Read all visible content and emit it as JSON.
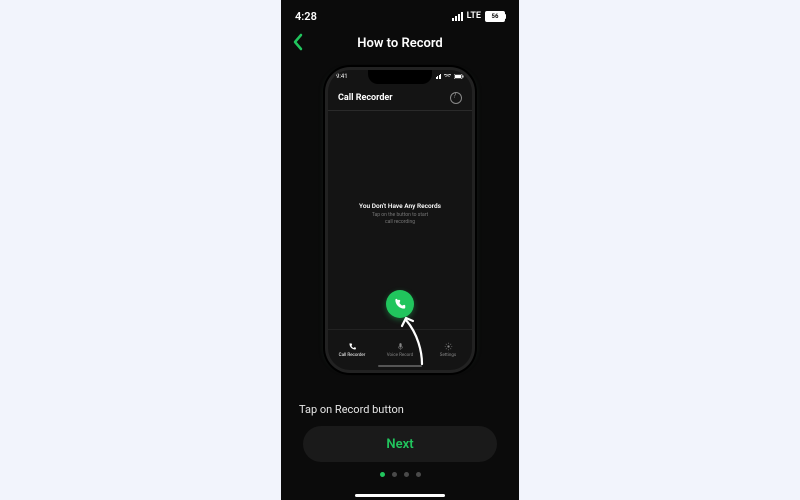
{
  "status": {
    "time": "4:28",
    "network": "LTE",
    "battery": "56"
  },
  "header": {
    "title": "How to Record"
  },
  "mock": {
    "time": "9:41",
    "title": "Call Recorder",
    "empty_title": "You Don't Have Any Records",
    "empty_sub1": "Tap on the button to start",
    "empty_sub2": "call recording",
    "tabs": [
      {
        "label": "Call Recorder"
      },
      {
        "label": "Voice Record"
      },
      {
        "label": "Settings"
      }
    ]
  },
  "instruction": "Tap on Record button",
  "next_label": "Next",
  "pager": {
    "count": 4,
    "active": 0
  },
  "accent": "#21c55d"
}
